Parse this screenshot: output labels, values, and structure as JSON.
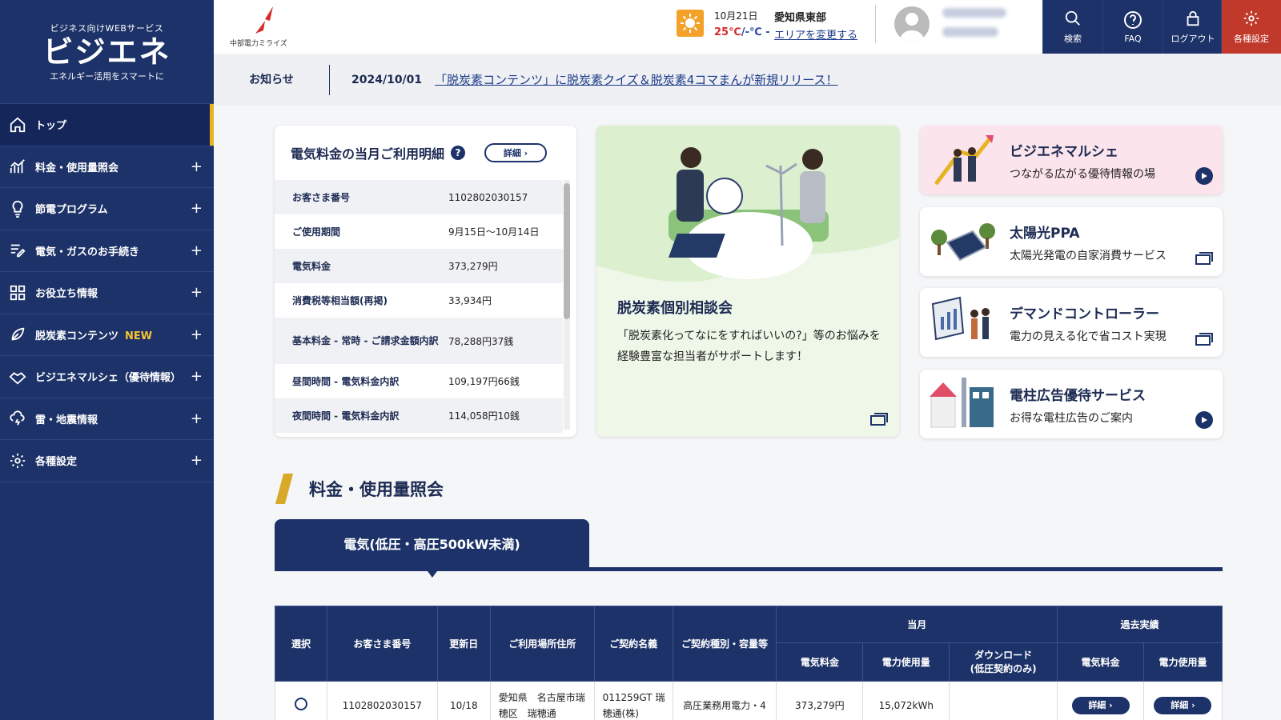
{
  "brand": {
    "tagline_top": "ビジネス向けWEBサービス",
    "name": "ビジエネ",
    "tagline_bottom": "エネルギー活用をスマートに",
    "company": "中部電力ミライズ",
    "accent": "#1c3268",
    "highlight": "#e6b422"
  },
  "sidebar": {
    "items": [
      {
        "label": "トップ",
        "icon": "home-icon"
      },
      {
        "label": "料金・使用量照会",
        "icon": "chart-icon"
      },
      {
        "label": "節電プログラム",
        "icon": "bulb-icon"
      },
      {
        "label": "電気・ガスのお手続き",
        "icon": "edit-list-icon"
      },
      {
        "label": "お役立ち情報",
        "icon": "grid-icon"
      },
      {
        "label": "脱炭素コンテンツ",
        "badge": "NEW",
        "icon": "leaf-icon"
      },
      {
        "label": "ビジエネマルシェ（優待情報）",
        "icon": "handshake-icon"
      },
      {
        "label": "雷・地震情報",
        "icon": "thunder-icon"
      },
      {
        "label": "各種設定",
        "icon": "gear-icon"
      }
    ]
  },
  "header": {
    "weather_date": "10月21日",
    "temp_high": "25℃",
    "temp_low": "/-℃ -",
    "area": "愛知県東部",
    "area_link": "エリアを変更する",
    "buttons": {
      "search": "検索",
      "faq": "FAQ",
      "logout": "ログアウト",
      "settings": "各種設定"
    }
  },
  "notice": {
    "title": "お知らせ",
    "date": "2024/10/01",
    "text": "「脱炭素コンテンツ」に脱炭素クイズ＆脱炭素4コマまんが新規リリース！"
  },
  "bill": {
    "title": "電気料金の当月ご利用明細",
    "help": "?",
    "detail": "詳細",
    "rows": [
      {
        "k": "お客さま番号",
        "v": "1102802030157"
      },
      {
        "k": "ご使用期間",
        "v": "9月15日〜10月14日"
      },
      {
        "k": "電気料金",
        "v": "373,279円"
      },
      {
        "k": "消費税等相当額(再掲)",
        "v": "33,934円"
      },
      {
        "k": "基本料金 - 常時 - ご請求金額内訳",
        "v": "78,288円37銭"
      },
      {
        "k": "昼間時間 - 電気料金内訳",
        "v": "109,197円66銭"
      },
      {
        "k": "夜間時間 - 電気料金内訳",
        "v": "114,058円10銭"
      }
    ]
  },
  "consult": {
    "title": "脱炭素個別相談会",
    "desc": "「脱炭素化ってなにをすればいいの?」等のお悩みを経験豊富な担当者がサポートします！"
  },
  "side_cards": [
    {
      "title": "ビジエネマルシェ",
      "sub": "つながる広がる優待情報の場"
    },
    {
      "title": "太陽光PPA",
      "sub": "太陽光発電の自家消費サービス"
    },
    {
      "title": "デマンドコントローラー",
      "sub": "電力の見える化で省コスト実現"
    },
    {
      "title": "電柱広告優待サービス",
      "sub": "お得な電柱広告のご案内"
    }
  ],
  "section": {
    "title": "料金・使用量照会",
    "tab": "電気(低圧・高圧500kW未満)"
  },
  "table": {
    "headers": {
      "select": "選択",
      "customer_no": "お客さま番号",
      "updated": "更新日",
      "address": "ご利用場所住所",
      "contract_name": "ご契約名義",
      "contract_type": "ご契約種別・容量等",
      "current": "当月",
      "past": "過去実績",
      "fee": "電気料金",
      "usage": "電力使用量",
      "download": "ダウンロード\n(低圧契約のみ)",
      "past_fee": "電気料金",
      "past_usage": "電力使用量"
    },
    "row": {
      "customer_no": "1102802030157",
      "updated": "10/18",
      "address": "愛知県　名古屋市瑞穂区　瑞穂通",
      "contract_name": "011259GT 瑞穂通(株)",
      "contract_type": "高圧業務用電力・4",
      "fee": "373,279円",
      "usage": "15,072kWh",
      "detail": "詳細"
    }
  }
}
